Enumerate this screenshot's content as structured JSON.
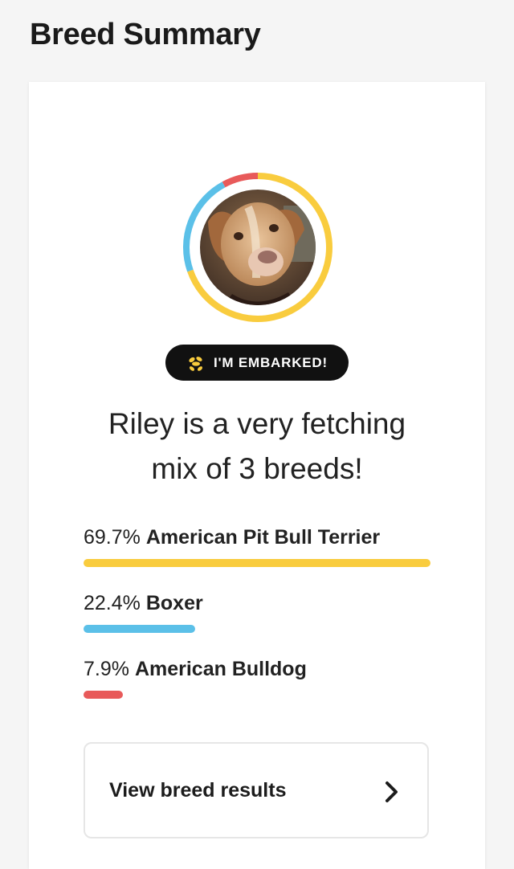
{
  "page": {
    "title": "Breed Summary"
  },
  "badge": {
    "label": "I'M EMBARKED!",
    "icon": "dog-balloon-icon"
  },
  "headline": {
    "line1": "Riley is a very fetching",
    "line2": "mix of 3 breeds!"
  },
  "breeds": [
    {
      "percent_label": "69.7%",
      "name": "American Pit Bull Terrier",
      "fraction": 0.697,
      "color": "#f9cc3e"
    },
    {
      "percent_label": "22.4%",
      "name": "Boxer",
      "fraction": 0.224,
      "color": "#5bc0e8"
    },
    {
      "percent_label": "7.9%",
      "name": "American Bulldog",
      "fraction": 0.079,
      "color": "#e85a5a"
    }
  ],
  "results_button": {
    "label": "View breed results",
    "icon": "chevron-right-icon"
  }
}
